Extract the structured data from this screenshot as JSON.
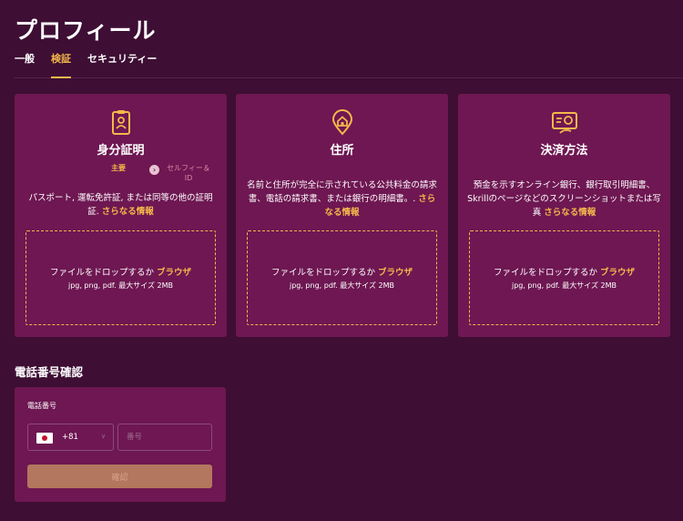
{
  "header": {
    "title": "プロフィール"
  },
  "tabs": [
    {
      "label": "一般"
    },
    {
      "label": "検証"
    },
    {
      "label": "セキュリティー"
    }
  ],
  "cards": [
    {
      "title": "身分証明",
      "icon": "id-card-icon",
      "step_primary": "主要",
      "step_secondary": "セルフィー＆ ID",
      "description": "パスポート, 運転免許証, または同等の他の証明証.",
      "more_link": "さらなる情報",
      "drop_text": "ファイルをドロップするか",
      "browse": "ブラウザ",
      "drop_hint": "jpg, png, pdf. 最大サイズ 2MB"
    },
    {
      "title": "住所",
      "icon": "location-home-icon",
      "description": "名前と住所が完全に示されている公共料金の請求書、電話の請求書、または銀行の明細書。.",
      "more_link": "さらなる情報",
      "drop_text": "ファイルをドロップするか",
      "browse": "ブラウザ",
      "drop_hint": "jpg, png, pdf. 最大サイズ 2MB"
    },
    {
      "title": "決済方法",
      "icon": "payment-method-icon",
      "description": "預金を示すオンライン銀行、銀行取引明細書、Skrillのページなどのスクリーンショットまたは写真",
      "more_link": "さらなる情報",
      "drop_text": "ファイルをドロップするか",
      "browse": "ブラウザ",
      "drop_hint": "jpg, png, pdf. 最大サイズ 2MB"
    }
  ],
  "phone": {
    "section_title": "電話番号確認",
    "label": "電話番号",
    "country_code": "+81",
    "number_placeholder": "番号",
    "confirm_label": "確認"
  },
  "colors": {
    "background": "#3e0e34",
    "card": "#6e1752",
    "accent": "#f2b84b",
    "button": "#b2775e"
  }
}
